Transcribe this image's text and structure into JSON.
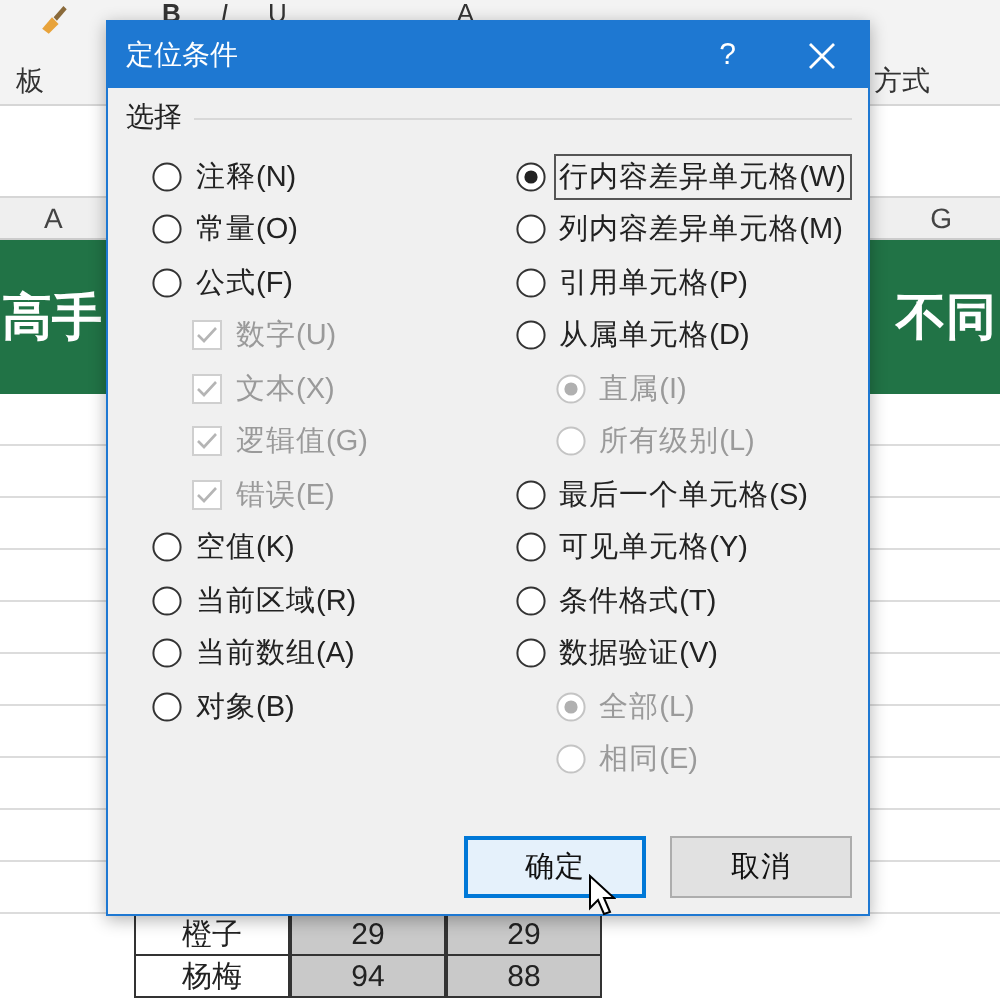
{
  "ribbon": {
    "tools": [
      "B",
      "I",
      "U",
      "A"
    ],
    "group_labels": [
      "板",
      "方式"
    ]
  },
  "column_headers": [
    "A",
    "G"
  ],
  "banner": {
    "left": "高手",
    "right": "不同"
  },
  "table": {
    "rows": [
      [
        "橙子",
        "29",
        "29"
      ],
      [
        "杨梅",
        "94",
        "88"
      ]
    ]
  },
  "dialog": {
    "title": "定位条件",
    "help": "?",
    "group_label": "选择",
    "left_options": [
      {
        "kind": "radio",
        "label": "注释(N)",
        "selected": false,
        "focused": false
      },
      {
        "kind": "radio",
        "label": "常量(O)",
        "selected": false,
        "focused": false
      },
      {
        "kind": "radio",
        "label": "公式(F)",
        "selected": false,
        "focused": false,
        "children": [
          {
            "kind": "checkbox",
            "label": "数字(U)",
            "checked": true,
            "disabled": true
          },
          {
            "kind": "checkbox",
            "label": "文本(X)",
            "checked": true,
            "disabled": true
          },
          {
            "kind": "checkbox",
            "label": "逻辑值(G)",
            "checked": true,
            "disabled": true
          },
          {
            "kind": "checkbox",
            "label": "错误(E)",
            "checked": true,
            "disabled": true
          }
        ]
      },
      {
        "kind": "radio",
        "label": "空值(K)",
        "selected": false,
        "focused": false
      },
      {
        "kind": "radio",
        "label": "当前区域(R)",
        "selected": false,
        "focused": false
      },
      {
        "kind": "radio",
        "label": "当前数组(A)",
        "selected": false,
        "focused": false
      },
      {
        "kind": "radio",
        "label": "对象(B)",
        "selected": false,
        "focused": false
      }
    ],
    "right_options": [
      {
        "kind": "radio",
        "label": "行内容差异单元格(W)",
        "selected": true,
        "focused": true
      },
      {
        "kind": "radio",
        "label": "列内容差异单元格(M)",
        "selected": false,
        "focused": false
      },
      {
        "kind": "radio",
        "label": "引用单元格(P)",
        "selected": false,
        "focused": false
      },
      {
        "kind": "radio",
        "label": "从属单元格(D)",
        "selected": false,
        "focused": false,
        "children": [
          {
            "kind": "radio",
            "label": "直属(I)",
            "selected": true,
            "disabled": true
          },
          {
            "kind": "radio",
            "label": "所有级别(L)",
            "selected": false,
            "disabled": true
          }
        ]
      },
      {
        "kind": "radio",
        "label": "最后一个单元格(S)",
        "selected": false,
        "focused": false
      },
      {
        "kind": "radio",
        "label": "可见单元格(Y)",
        "selected": false,
        "focused": false
      },
      {
        "kind": "radio",
        "label": "条件格式(T)",
        "selected": false,
        "focused": false
      },
      {
        "kind": "radio",
        "label": "数据验证(V)",
        "selected": false,
        "focused": false,
        "children": [
          {
            "kind": "radio",
            "label": "全部(L)",
            "selected": true,
            "disabled": true
          },
          {
            "kind": "radio",
            "label": "相同(E)",
            "selected": false,
            "disabled": true
          }
        ]
      }
    ],
    "buttons": [
      {
        "label": "确定",
        "default": true
      },
      {
        "label": "取消",
        "default": false
      }
    ]
  }
}
